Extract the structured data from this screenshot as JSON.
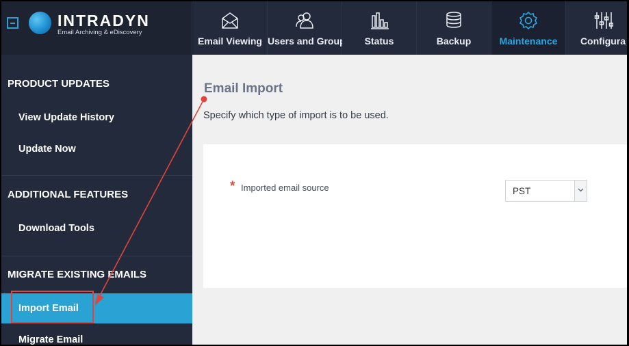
{
  "brand": {
    "name": "INTRADYN",
    "tagline": "Email Archiving & eDiscovery",
    "accent_color": "#2aa0d6"
  },
  "nav": {
    "tabs": [
      {
        "label": "Email Viewing",
        "icon": "envelope-icon",
        "active": false
      },
      {
        "label": "Users and Groups",
        "icon": "users-icon",
        "active": false
      },
      {
        "label": "Status",
        "icon": "bar-chart-icon",
        "active": false
      },
      {
        "label": "Backup",
        "icon": "database-icon",
        "active": false
      },
      {
        "label": "Maintenance",
        "icon": "gear-icon",
        "active": true
      },
      {
        "label": "Configura",
        "icon": "sliders-icon",
        "active": false
      }
    ]
  },
  "sidebar": {
    "sections": [
      {
        "title": "PRODUCT UPDATES",
        "items": [
          {
            "label": "View Update History"
          },
          {
            "label": "Update Now"
          }
        ]
      },
      {
        "title": "ADDITIONAL FEATURES",
        "items": [
          {
            "label": "Download Tools"
          }
        ]
      },
      {
        "title": "MIGRATE EXISTING EMAILS",
        "items": [
          {
            "label": "Import Email",
            "active": true
          },
          {
            "label": "Migrate Email"
          }
        ]
      }
    ],
    "active_color": "#2aa2d3"
  },
  "main": {
    "title": "Email Import",
    "subtitle": "Specify which type of import is to be used.",
    "form": {
      "required_mark": "*",
      "source_label": "Imported email source",
      "source_value": "PST"
    }
  },
  "annotation": {
    "color": "#e0443b"
  }
}
